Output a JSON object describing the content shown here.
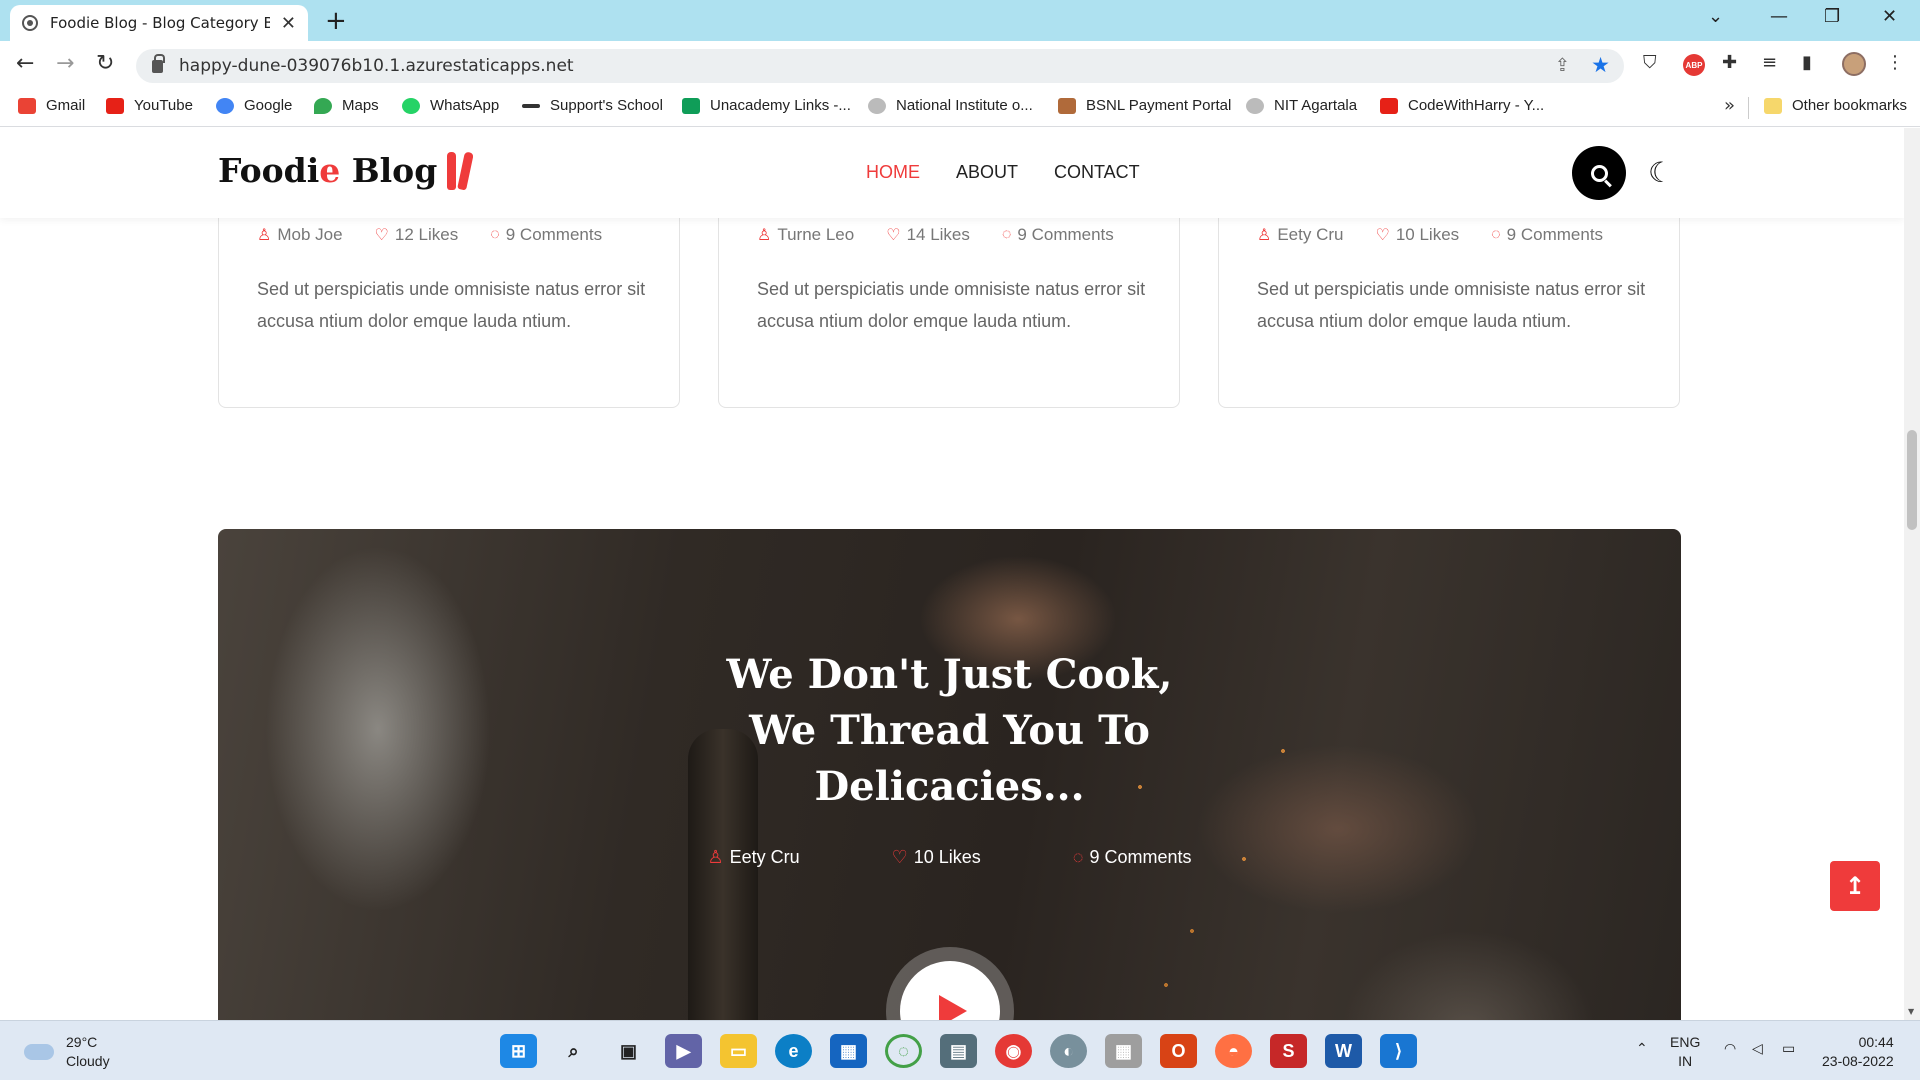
{
  "browser": {
    "tab_title": "Foodie Blog - Blog Category Boo",
    "url": "happy-dune-039076b10.1.azurestaticapps.net",
    "bookmarks": [
      {
        "label": "Gmail",
        "color": "#ea4335"
      },
      {
        "label": "YouTube",
        "color": "#e62117"
      },
      {
        "label": "Google",
        "color": "#4285f4"
      },
      {
        "label": "Maps",
        "color": "#34a853"
      },
      {
        "label": "WhatsApp",
        "color": "#25d366"
      },
      {
        "label": "Support's School",
        "color": "#333333"
      },
      {
        "label": "Unacademy Links -...",
        "color": "#0f9d58"
      },
      {
        "label": "National Institute o...",
        "color": "#999999"
      },
      {
        "label": "BSNL Payment Portal",
        "color": "#b06a3a"
      },
      {
        "label": "NIT Agartala",
        "color": "#999999"
      },
      {
        "label": "CodeWithHarry - Y...",
        "color": "#e62117"
      }
    ],
    "other_bookmarks": "Other bookmarks"
  },
  "site": {
    "logo_main": "Foodi",
    "logo_accent": "e",
    "logo_tail": " Blog",
    "nav": [
      "HOME",
      "ABOUT",
      "CONTACT"
    ],
    "accent_color": "#ef3b3b"
  },
  "cards": [
    {
      "author": "Mob Joe",
      "likes": "12 Likes",
      "comments": "9 Comments",
      "excerpt": "Sed ut perspiciatis unde omnisiste natus error sit accusa ntium dolor emque lauda ntium."
    },
    {
      "author": "Turne Leo",
      "likes": "14 Likes",
      "comments": "9 Comments",
      "excerpt": "Sed ut perspiciatis unde omnisiste natus error sit accusa ntium dolor emque lauda ntium."
    },
    {
      "author": "Eety Cru",
      "likes": "10 Likes",
      "comments": "9 Comments",
      "excerpt": "Sed ut perspiciatis unde omnisiste natus error sit accusa ntium dolor emque lauda ntium."
    }
  ],
  "hero": {
    "title": "We Don't Just Cook, We Thread You To Delicacies...",
    "author": "Eety Cru",
    "likes": "10 Likes",
    "comments": "9 Comments"
  },
  "taskbar": {
    "temp": "29°C",
    "condition": "Cloudy",
    "lang1": "ENG",
    "lang2": "IN",
    "time": "00:44",
    "date": "23-08-2022"
  }
}
